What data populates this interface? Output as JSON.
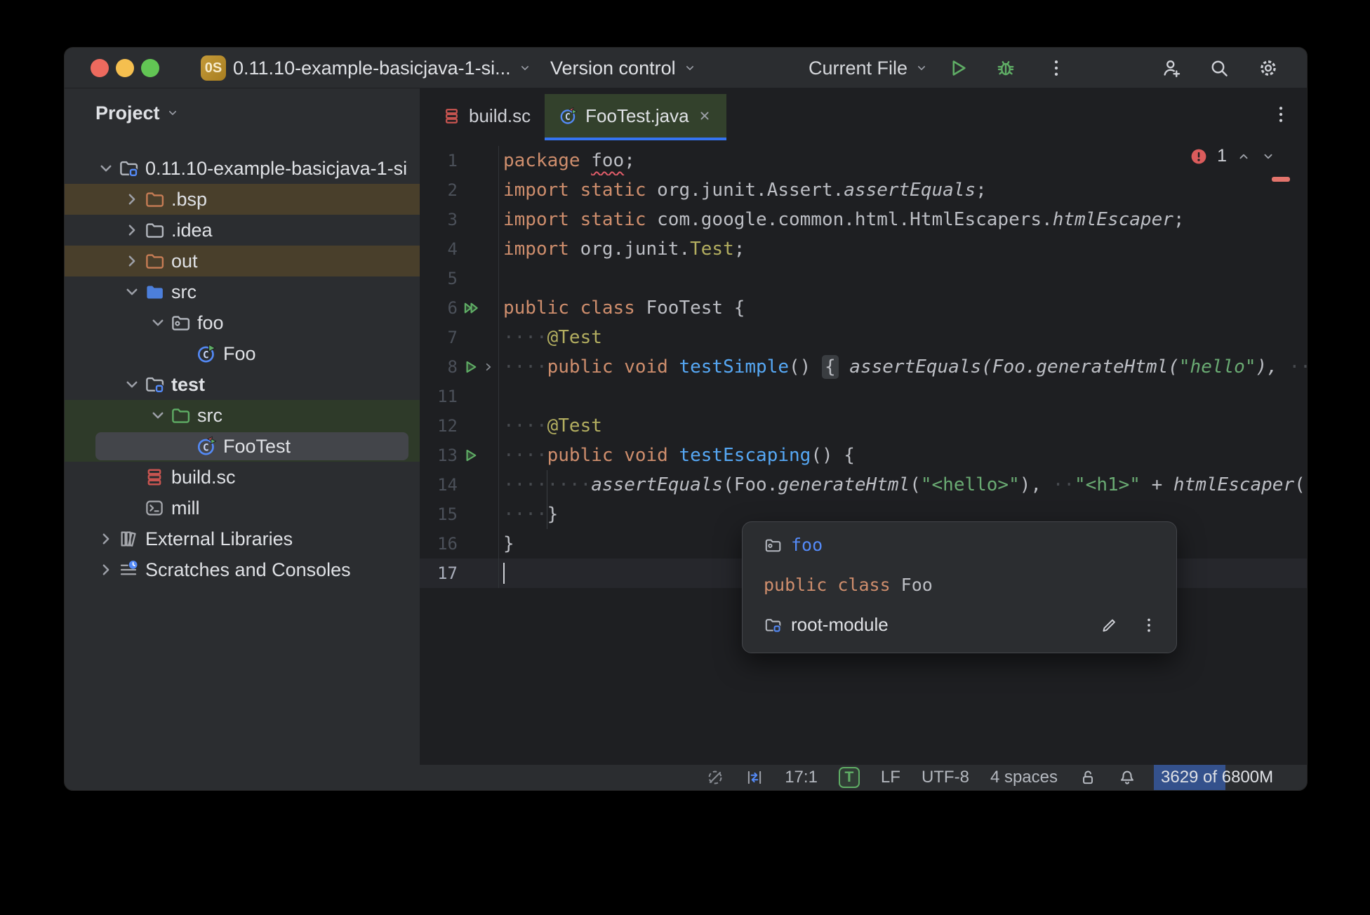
{
  "titlebar": {
    "project_badge": "0S",
    "project_name": "0.11.10-example-basicjava-1-si...",
    "vcs_widget": "Version control",
    "run_config": "Current File"
  },
  "project_panel": {
    "header": "Project",
    "tree": [
      {
        "label": "0.11.10-example-basicjava-1-si",
        "icon": "folder-module",
        "level": 0,
        "chevron": "down",
        "bg": "",
        "bold": false,
        "selected": false
      },
      {
        "label": ".bsp",
        "icon": "folder-excluded",
        "level": 1,
        "chevron": "right",
        "bg": "excluded",
        "bold": false,
        "selected": false
      },
      {
        "label": ".idea",
        "icon": "folder-plain",
        "level": 1,
        "chevron": "right",
        "bg": "",
        "bold": false,
        "selected": false
      },
      {
        "label": "out",
        "icon": "folder-excluded",
        "level": 1,
        "chevron": "right",
        "bg": "excluded",
        "bold": false,
        "selected": false
      },
      {
        "label": "src",
        "icon": "folder-src",
        "level": 1,
        "chevron": "down",
        "bg": "",
        "bold": false,
        "selected": false
      },
      {
        "label": "foo",
        "icon": "folder-package",
        "level": 2,
        "chevron": "down",
        "bg": "",
        "bold": false,
        "selected": false
      },
      {
        "label": "Foo",
        "icon": "class-run",
        "level": 3,
        "chevron": "",
        "bg": "",
        "bold": false,
        "selected": false
      },
      {
        "label": "test",
        "icon": "folder-module",
        "level": 1,
        "chevron": "down",
        "bg": "",
        "bold": true,
        "selected": false
      },
      {
        "label": "src",
        "icon": "folder-test",
        "level": 2,
        "chevron": "down",
        "bg": "test",
        "bold": false,
        "selected": false
      },
      {
        "label": "FooTest",
        "icon": "class-test",
        "level": 3,
        "chevron": "",
        "bg": "test",
        "bold": false,
        "selected": true
      },
      {
        "label": "build.sc",
        "icon": "scala-file",
        "level": 1,
        "chevron": "",
        "bg": "",
        "bold": false,
        "selected": false
      },
      {
        "label": "mill",
        "icon": "terminal-file",
        "level": 1,
        "chevron": "",
        "bg": "",
        "bold": false,
        "selected": false
      },
      {
        "label": "External Libraries",
        "icon": "libraries",
        "level": 0,
        "chevron": "right",
        "bg": "",
        "bold": false,
        "selected": false
      },
      {
        "label": "Scratches and Consoles",
        "icon": "scratches",
        "level": 0,
        "chevron": "right",
        "bg": "",
        "bold": false,
        "selected": false
      }
    ]
  },
  "tabs": [
    {
      "label": "build.sc",
      "icon": "scala-file",
      "active": false
    },
    {
      "label": "FooTest.java",
      "icon": "class-test",
      "active": true
    }
  ],
  "editor": {
    "error_count": "1",
    "lines": [
      {
        "num": "1",
        "gutter": "",
        "segs": [
          [
            "k",
            "package "
          ],
          [
            "e",
            "foo"
          ],
          [
            "p",
            ";"
          ]
        ],
        "current": false
      },
      {
        "num": "2",
        "gutter": "",
        "segs": [
          [
            "k",
            "import static "
          ],
          [
            "p",
            "org.junit.Assert."
          ],
          [
            "i",
            "assertEquals"
          ],
          [
            "p",
            ";"
          ]
        ],
        "current": false
      },
      {
        "num": "3",
        "gutter": "",
        "segs": [
          [
            "k",
            "import static "
          ],
          [
            "p",
            "com.google.common.html.HtmlEscapers."
          ],
          [
            "i",
            "htmlEscaper"
          ],
          [
            "p",
            ";"
          ]
        ],
        "current": false
      },
      {
        "num": "4",
        "gutter": "",
        "segs": [
          [
            "k",
            "import "
          ],
          [
            "p",
            "org.junit."
          ],
          [
            "a",
            "Test"
          ],
          [
            "p",
            ";"
          ]
        ],
        "current": false
      },
      {
        "num": "5",
        "gutter": "",
        "segs": [],
        "current": false
      },
      {
        "num": "6",
        "gutter": "run2",
        "segs": [
          [
            "k",
            "public class "
          ],
          [
            "p",
            "FooTest {"
          ]
        ],
        "current": false
      },
      {
        "num": "7",
        "gutter": "",
        "segs": [
          [
            "w",
            "····"
          ],
          [
            "a",
            "@Test"
          ]
        ],
        "current": false
      },
      {
        "num": "8",
        "gutter": "run-fold",
        "segs": [
          [
            "w",
            "····"
          ],
          [
            "k",
            "public void "
          ],
          [
            "m",
            "testSimple"
          ],
          [
            "p",
            "() "
          ],
          [
            "f",
            "{"
          ],
          [
            "p",
            " "
          ],
          [
            "i",
            "assertEquals(Foo.generateHtml("
          ],
          [
            "is",
            "\"hello\""
          ],
          [
            "i",
            "), "
          ],
          [
            "w",
            "··"
          ]
        ],
        "current": false
      },
      {
        "num": "11",
        "gutter": "",
        "segs": [],
        "current": false
      },
      {
        "num": "12",
        "gutter": "",
        "segs": [
          [
            "w",
            "····"
          ],
          [
            "a",
            "@Test"
          ]
        ],
        "current": false
      },
      {
        "num": "13",
        "gutter": "run1",
        "segs": [
          [
            "w",
            "····"
          ],
          [
            "k",
            "public void "
          ],
          [
            "m",
            "testEscaping"
          ],
          [
            "p",
            "() {"
          ]
        ],
        "current": false
      },
      {
        "num": "14",
        "gutter": "",
        "segs": [
          [
            "w",
            "········"
          ],
          [
            "i",
            "assertEquals"
          ],
          [
            "p",
            "(Foo."
          ],
          [
            "i",
            "generateHtml"
          ],
          [
            "p",
            "("
          ],
          [
            "s",
            "\"<hello>\""
          ],
          [
            "p",
            "), "
          ],
          [
            "w",
            "··"
          ],
          [
            "s",
            "\"<h1>\""
          ],
          [
            "p",
            " + "
          ],
          [
            "i",
            "htmlEscaper"
          ],
          [
            "p",
            "("
          ]
        ],
        "current": false
      },
      {
        "num": "15",
        "gutter": "",
        "segs": [
          [
            "w",
            "····"
          ],
          [
            "p",
            "}"
          ]
        ],
        "current": false
      },
      {
        "num": "16",
        "gutter": "",
        "segs": [
          [
            "p",
            "}"
          ]
        ],
        "current": false
      },
      {
        "num": "17",
        "gutter": "",
        "segs": [],
        "current": true
      }
    ]
  },
  "popup": {
    "package_label": "foo",
    "class_keyword": "public class ",
    "class_name": "Foo",
    "module_label": "root-module"
  },
  "statusbar": {
    "position": "17:1",
    "type_badge": "T",
    "line_ending": "LF",
    "encoding": "UTF-8",
    "indent": "4 spaces",
    "memory": "3629 of 6800M"
  },
  "colors": {
    "accent": "#3574F0",
    "run_green": "#5FAD65",
    "error_red": "#DB5C5C",
    "test_tab": "#33412C"
  }
}
